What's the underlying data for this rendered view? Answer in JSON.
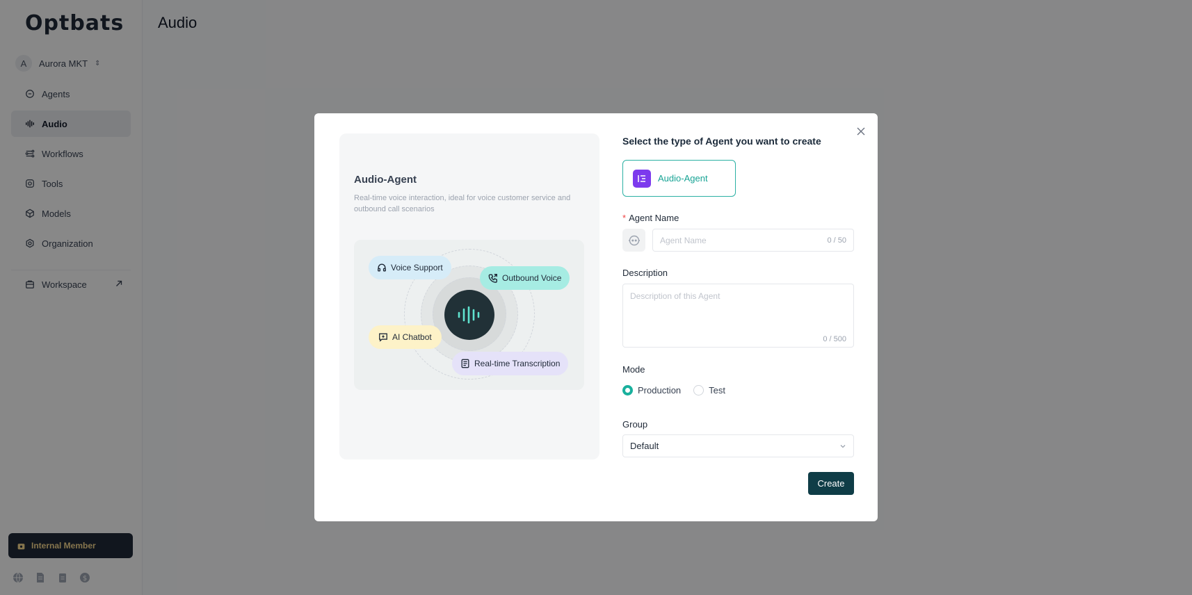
{
  "app": {
    "logo": "Optbats",
    "org": {
      "initial": "A",
      "name": "Aurora MKT"
    },
    "nav": [
      {
        "label": "Agents",
        "icon": "chat-bubble-icon"
      },
      {
        "label": "Audio",
        "icon": "audio-wave-icon",
        "active": true
      },
      {
        "label": "Workflows",
        "icon": "workflow-icon"
      },
      {
        "label": "Tools",
        "icon": "tools-icon"
      },
      {
        "label": "Models",
        "icon": "cube-icon"
      },
      {
        "label": "Organization",
        "icon": "organization-icon"
      }
    ],
    "workspace": "Workspace",
    "member_badge": "Internal Member",
    "page_title": "Audio"
  },
  "modal": {
    "preview": {
      "title": "Audio-Agent",
      "description": "Real-time voice interaction, ideal for voice customer service and outbound call scenarios",
      "chips": {
        "voice_support": "Voice Support",
        "outbound_voice": "Outbound Voice",
        "ai_chatbot": "AI Chatbot",
        "transcription": "Real-time Transcription"
      }
    },
    "form": {
      "title": "Select the type of Agent you want to create",
      "type_option": "Audio-Agent",
      "name_label": "Agent Name",
      "name_required_mark": "*",
      "name_placeholder": "Agent Name",
      "name_counter": "0 / 50",
      "description_label": "Description",
      "description_placeholder": "Description of this Agent",
      "description_counter": "0 / 500",
      "mode_label": "Mode",
      "mode_options": [
        "Production",
        "Test"
      ],
      "mode_selected": "Production",
      "group_label": "Group",
      "group_value": "Default",
      "create_label": "Create"
    }
  },
  "colors": {
    "accent": "#19b09d",
    "primary_button": "#0f3d47",
    "type_icon": "#7c3aed",
    "chip_voice_support": "#d6ecf8",
    "chip_outbound_voice": "#a6ece3",
    "chip_ai_chatbot": "#fdf2c8",
    "chip_transcription": "#e5e2f9"
  }
}
